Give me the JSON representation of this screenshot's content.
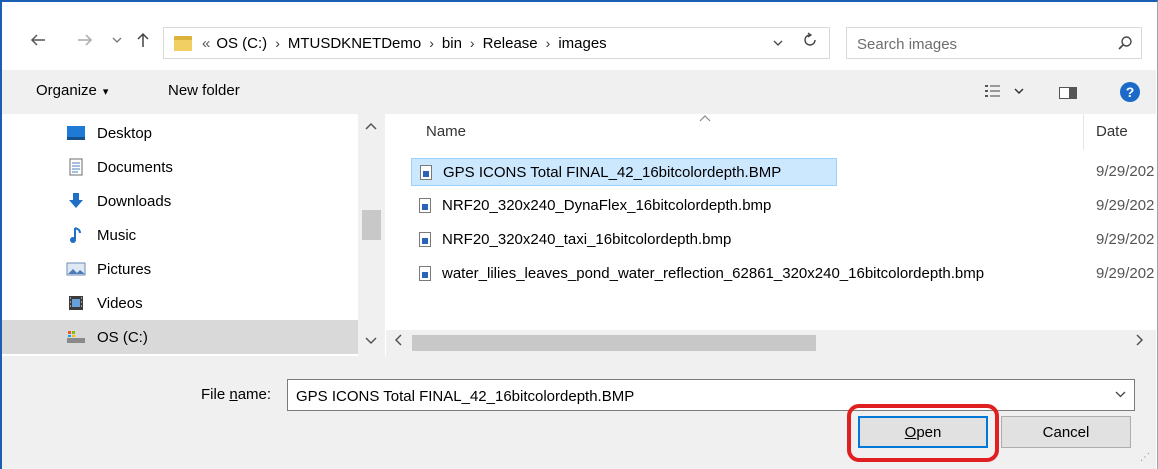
{
  "nav": {
    "back_icon": "back-arrow-icon",
    "forward_icon": "forward-arrow-icon",
    "recent_icon": "chevron-down-icon",
    "up_icon": "up-arrow-icon",
    "overflow": "«",
    "breadcrumbs": [
      "OS (C:)",
      "MTUSDKNETDemo",
      "bin",
      "Release",
      "images"
    ],
    "separator": "›"
  },
  "search": {
    "placeholder": "Search images"
  },
  "toolbar": {
    "organize_label": "Organize",
    "organize_caret": "▾",
    "new_folder_label": "New folder"
  },
  "sidebar": {
    "items": [
      {
        "label": "Desktop",
        "icon": "desktop-icon"
      },
      {
        "label": "Documents",
        "icon": "documents-icon"
      },
      {
        "label": "Downloads",
        "icon": "downloads-icon"
      },
      {
        "label": "Music",
        "icon": "music-icon"
      },
      {
        "label": "Pictures",
        "icon": "pictures-icon"
      },
      {
        "label": "Videos",
        "icon": "videos-icon"
      },
      {
        "label": "OS (C:)",
        "icon": "drive-icon",
        "selected": true
      }
    ]
  },
  "file_list": {
    "columns": {
      "name": "Name",
      "date": "Date"
    },
    "rows": [
      {
        "name": "GPS ICONS Total FINAL_42_16bitcolordepth.BMP",
        "date": "9/29/202",
        "selected": true
      },
      {
        "name": "NRF20_320x240_DynaFlex_16bitcolordepth.bmp",
        "date": "9/29/202"
      },
      {
        "name": "NRF20_320x240_taxi_16bitcolordepth.bmp",
        "date": "9/29/202"
      },
      {
        "name": "water_lilies_leaves_pond_water_reflection_62861_320x240_16bitcolordepth.bmp",
        "date": "9/29/202"
      }
    ]
  },
  "footer": {
    "file_name_label_pre": "File ",
    "file_name_label_mnemonic": "n",
    "file_name_label_post": "ame:",
    "file_name_value": "GPS ICONS Total FINAL_42_16bitcolordepth.BMP",
    "open_label_mnemonic": "O",
    "open_label_rest": "pen",
    "cancel_label": "Cancel"
  },
  "colors": {
    "selection": "#cce8ff",
    "accent": "#0078d7",
    "annotation": "#e02020"
  }
}
